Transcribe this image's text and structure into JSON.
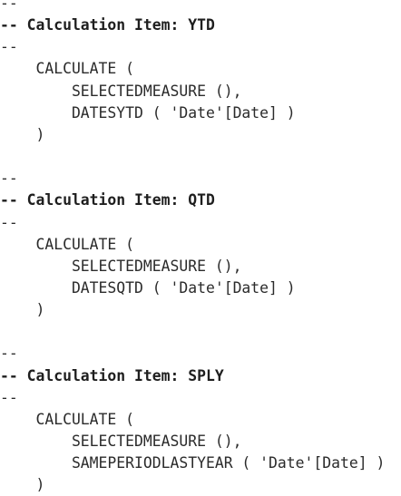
{
  "code_lines": [
    {
      "text": "--",
      "bold": false
    },
    {
      "text": "-- Calculation Item: YTD",
      "bold": true
    },
    {
      "text": "--",
      "bold": false
    },
    {
      "text": "    CALCULATE (",
      "bold": false
    },
    {
      "text": "        SELECTEDMEASURE (),",
      "bold": false
    },
    {
      "text": "        DATESYTD ( 'Date'[Date] )",
      "bold": false
    },
    {
      "text": "    )",
      "bold": false
    },
    {
      "text": "",
      "bold": false
    },
    {
      "text": "--",
      "bold": false
    },
    {
      "text": "-- Calculation Item: QTD",
      "bold": true
    },
    {
      "text": "--",
      "bold": false
    },
    {
      "text": "    CALCULATE (",
      "bold": false
    },
    {
      "text": "        SELECTEDMEASURE (),",
      "bold": false
    },
    {
      "text": "        DATESQTD ( 'Date'[Date] )",
      "bold": false
    },
    {
      "text": "    )",
      "bold": false
    },
    {
      "text": "",
      "bold": false
    },
    {
      "text": "--",
      "bold": false
    },
    {
      "text": "-- Calculation Item: SPLY",
      "bold": true
    },
    {
      "text": "--",
      "bold": false
    },
    {
      "text": "    CALCULATE (",
      "bold": false
    },
    {
      "text": "        SELECTEDMEASURE (),",
      "bold": false
    },
    {
      "text": "        SAMEPERIODLASTYEAR ( 'Date'[Date] )",
      "bold": false
    },
    {
      "text": "    )",
      "bold": false
    }
  ]
}
